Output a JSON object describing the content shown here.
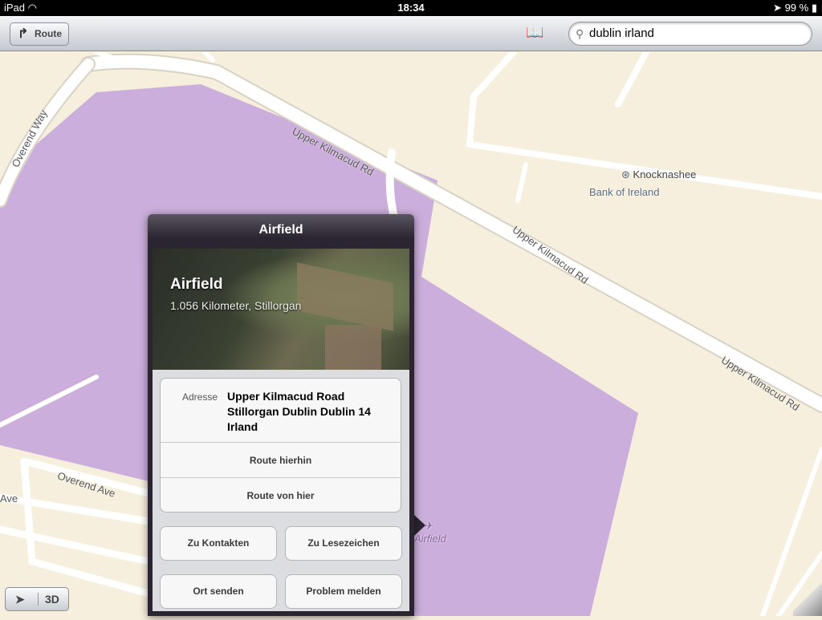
{
  "status": {
    "device": "iPad",
    "time": "18:34",
    "battery": "99 %"
  },
  "toolbar": {
    "route_label": "Route",
    "search_value": "dublin irland"
  },
  "map": {
    "labels": {
      "upper1": "Upper Kilmacud Rd",
      "upper2": "Upper Kilmacud Rd",
      "upper3": "Upper Kilmacud Rd",
      "overend_way": "Overend Way",
      "overend_ave": "Overend Ave",
      "ave": "Ave",
      "knocknashee": "Knocknashee",
      "bank": "Bank of Ireland",
      "airfield": "Airfield"
    },
    "area_color": "#cbaedb",
    "land_color": "#f6efdd"
  },
  "popup": {
    "title": "Airfield",
    "name": "Airfield",
    "distance": "1.056 Kilometer, Stillorgan",
    "address_label": "Adresse",
    "address": "Upper Kilmacud Road Stillorgan Dublin Dublin 14 Irland",
    "route_to": "Route hierhin",
    "route_from": "Route von hier",
    "add_contact": "Zu Kontakten",
    "add_bookmark": "Zu Lesezeichen",
    "share": "Ort senden",
    "report": "Problem melden"
  },
  "controls": {
    "threed": "3D"
  }
}
